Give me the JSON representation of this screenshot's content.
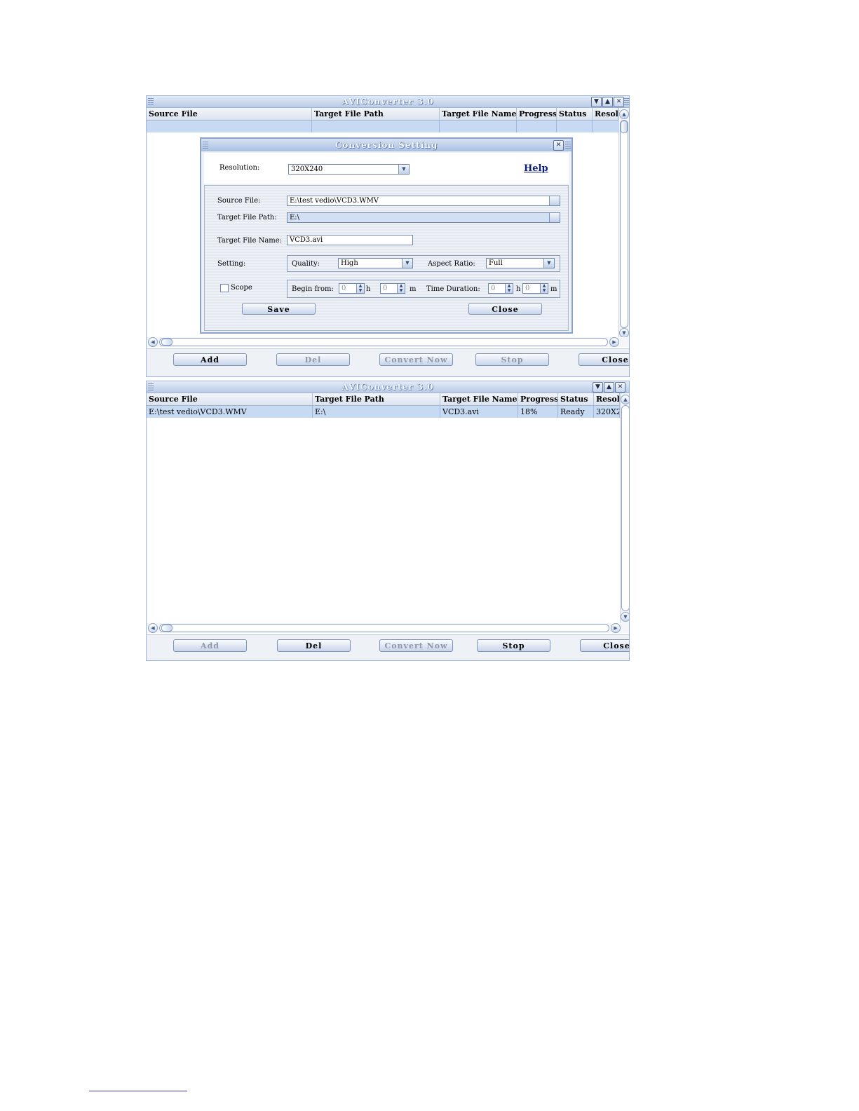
{
  "window1": {
    "title": "AVIConverter 3.0",
    "columns": [
      "Source File",
      "Target File Path",
      "Target File Name",
      "Progress",
      "Status",
      "Resol"
    ],
    "buttons": {
      "add": "Add",
      "del": "Del",
      "convert": "Convert Now",
      "stop": "Stop",
      "close": "Close"
    }
  },
  "dialog": {
    "title": "Conversion Setting",
    "resolution_label": "Resolution:",
    "resolution_value": "320X240",
    "help_label": "Help",
    "source_label": "Source File:",
    "source_value": "E:\\test vedio\\VCD3.WMV",
    "target_path_label": "Target File Path:",
    "target_path_value": "E:\\",
    "target_name_label": "Target File Name:",
    "target_name_value": "VCD3.avi",
    "setting_label": "Setting:",
    "quality_label": "Quality:",
    "quality_value": "High",
    "aspect_label": "Aspect Ratio:",
    "aspect_value": "Full",
    "scope_label": "Scope",
    "begin_label": "Begin from:",
    "begin_h": "0",
    "h_unit": "h",
    "begin_m": "0",
    "m_unit": "m",
    "duration_label": "Time Duration:",
    "duration_h": "0",
    "duration_m": "0",
    "save_label": "Save",
    "close_label": "Close"
  },
  "window2": {
    "title": "AVIConverter 3.0",
    "columns": [
      "Source File",
      "Target File Path",
      "Target File Name",
      "Progress",
      "Status",
      "Resol"
    ],
    "row": {
      "source": "E:\\test vedio\\VCD3.WMV",
      "path": "E:\\",
      "name": "VCD3.avi",
      "progress": "18%",
      "status": "Ready",
      "resolution": "320X2"
    },
    "buttons": {
      "add": "Add",
      "del": "Del",
      "convert": "Convert Now",
      "stop": "Stop",
      "close": "Close"
    }
  }
}
